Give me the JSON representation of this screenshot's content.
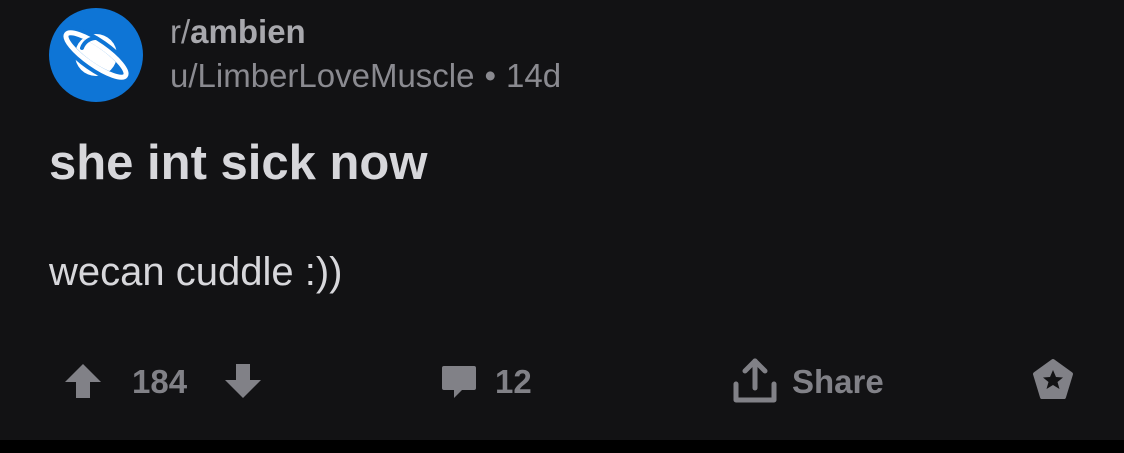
{
  "post": {
    "subreddit_prefix": "r/",
    "subreddit_name": "ambien",
    "author": "u/LimberLoveMuscle",
    "separator": "•",
    "age": "14d",
    "title": "she int sick now",
    "body": "wecan cuddle :))"
  },
  "actions": {
    "score": "184",
    "comments": "12",
    "share_label": "Share"
  },
  "icons": {
    "avatar": "planet-icon",
    "upvote": "arrow-up-icon",
    "downvote": "arrow-down-icon",
    "comments": "comment-bubble-icon",
    "share": "share-upload-icon",
    "award": "award-star-icon"
  },
  "colors": {
    "avatar_bg": "#0e75d6",
    "background": "#121214",
    "text": "#d7d7db",
    "muted": "#818187"
  }
}
